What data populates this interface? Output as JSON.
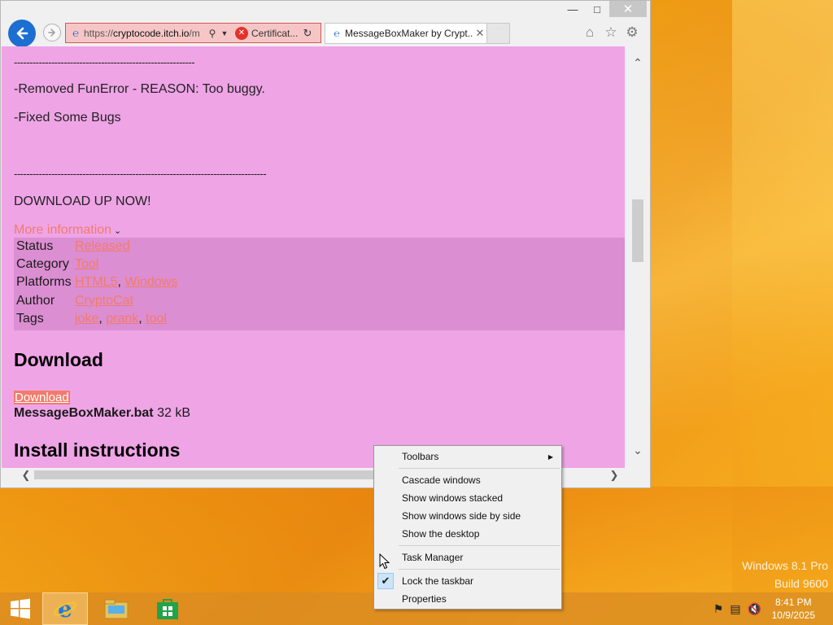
{
  "browser": {
    "address_url_prefix": "https://",
    "address_url_domain": "cryptocode.itch.io",
    "address_url_rest": "/m",
    "cert_label": "Certificat...",
    "tab_title": "MessageBoxMaker by Crypt...",
    "icons": {
      "back": "back-arrow-icon",
      "forward": "forward-arrow-icon",
      "home": "home-icon",
      "favorites": "star-icon",
      "settings": "gear-icon"
    }
  },
  "page": {
    "dashes_short": "----------------------------------------------------------",
    "removed_line": "-Removed FunError -  REASON: Too buggy.",
    "fixed_line": "-Fixed Some Bugs",
    "dashes_long": "---------------------------------------------------------------------------------",
    "download_up": "DOWNLOAD UP NOW!",
    "more_info": "More information",
    "info": [
      {
        "key": "Status",
        "values": [
          "Released"
        ]
      },
      {
        "key": "Category",
        "values": [
          "Tool"
        ]
      },
      {
        "key": "Platforms",
        "values": [
          "HTML5",
          "Windows"
        ]
      },
      {
        "key": "Author",
        "values": [
          "CryptoCat"
        ]
      },
      {
        "key": "Tags",
        "values": [
          "joke",
          "prank",
          "tool"
        ]
      }
    ],
    "download_heading": "Download",
    "download_button": "Download",
    "file_name": "MessageBoxMaker.bat",
    "file_size": "32 kB",
    "install_heading": "Install instructions"
  },
  "context_menu": {
    "items": [
      {
        "label": "Toolbars",
        "submenu": true
      },
      {
        "label": "Cascade windows"
      },
      {
        "label": "Show windows stacked"
      },
      {
        "label": "Show windows side by side"
      },
      {
        "label": "Show the desktop"
      },
      {
        "label": "Task Manager"
      },
      {
        "label": "Lock the taskbar",
        "checked": true
      },
      {
        "label": "Properties"
      }
    ]
  },
  "watermark": {
    "line1": "Windows 8.1 Pro",
    "line2": "Build 9600"
  },
  "taskbar": {
    "time": "8:41 PM",
    "date": "10/9/2025",
    "apps": [
      "internet-explorer-icon",
      "file-explorer-icon",
      "store-icon"
    ],
    "tray_icons": [
      "flag-icon",
      "network-icon",
      "volume-muted-icon"
    ]
  }
}
